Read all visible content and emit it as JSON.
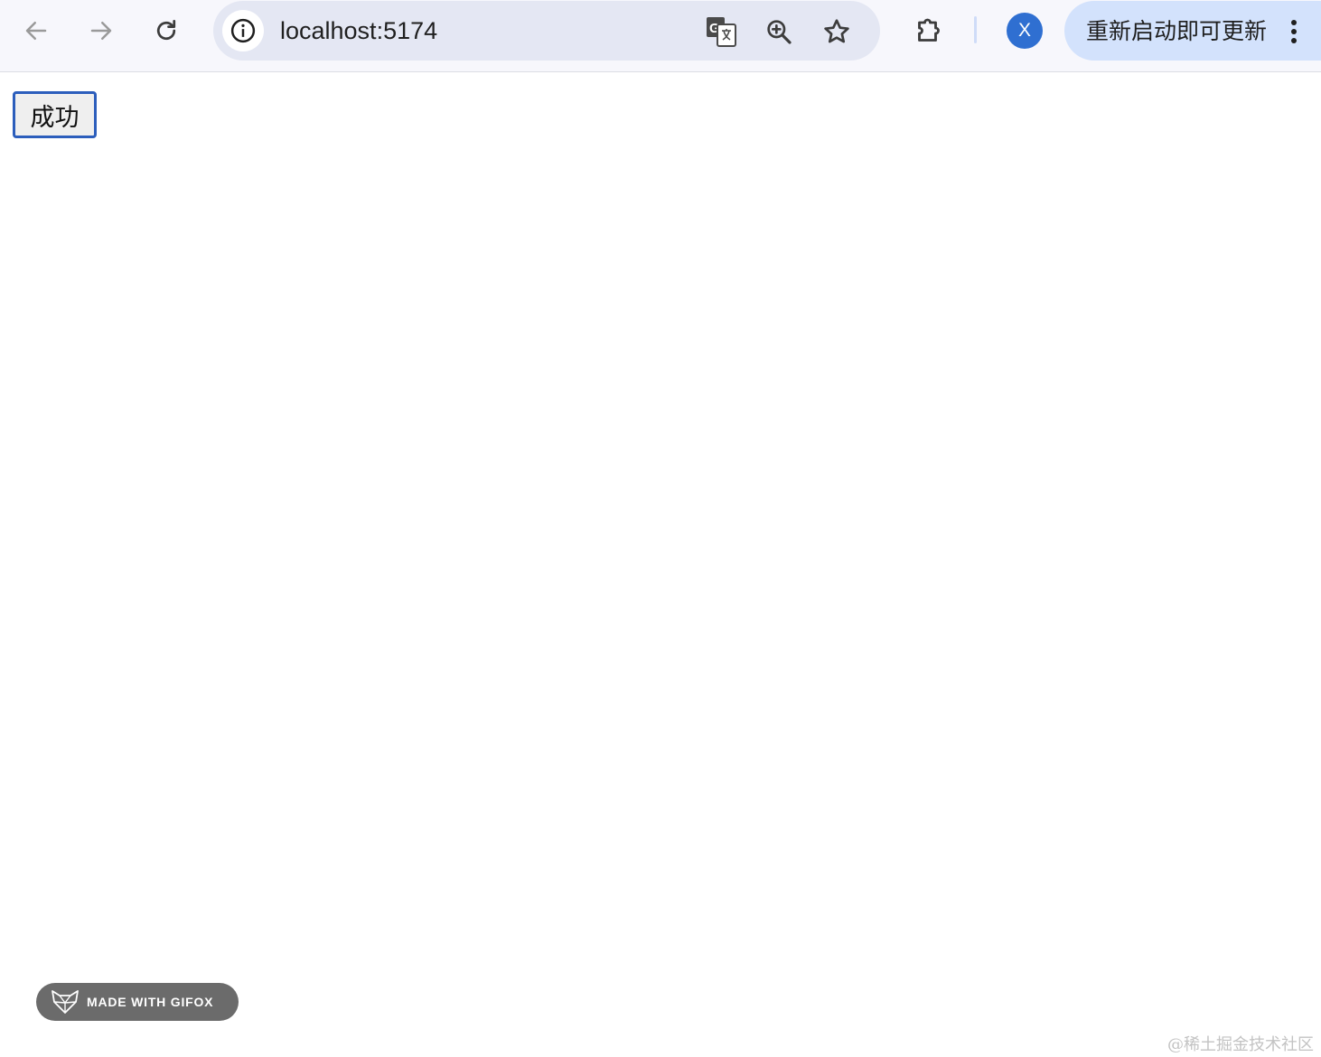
{
  "browser": {
    "url": "localhost:5174",
    "profile_initial": "X",
    "update_label": "重新启动即可更新",
    "icons": {
      "back": "arrow-left-icon",
      "forward": "arrow-right-icon",
      "reload": "reload-icon",
      "site_info": "info-icon",
      "translate": "translate-icon",
      "zoom": "zoom-in-icon",
      "bookmark": "star-icon",
      "extensions": "puzzle-icon",
      "menu": "kebab-menu-icon"
    },
    "colors": {
      "avatar": "#2f6fd1",
      "update_pill": "#d3e2fc",
      "omnibox": "#e4e7f3"
    }
  },
  "page": {
    "button_label": "成功"
  },
  "overlay": {
    "gifox_label": "MADE WITH GIFOX",
    "watermark": "@稀土掘金技术社区"
  }
}
